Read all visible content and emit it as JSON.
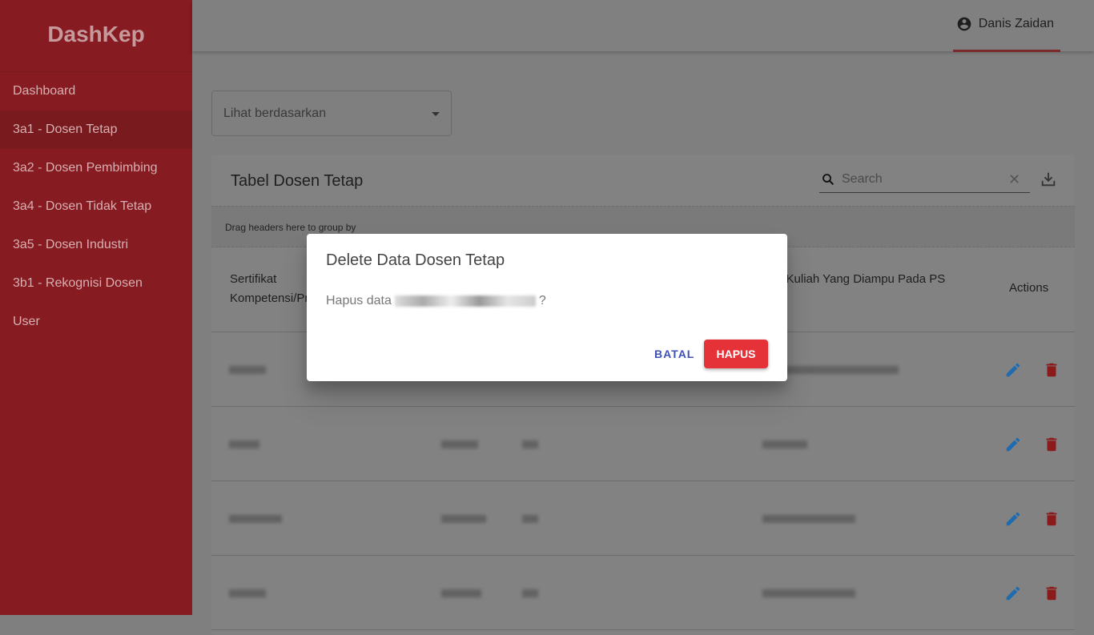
{
  "sidebar": {
    "brand": "DashKep",
    "items": [
      {
        "label": "Dashboard"
      },
      {
        "label": "3a1 - Dosen Tetap",
        "active": true
      },
      {
        "label": "3a2 - Dosen Pembimbing"
      },
      {
        "label": "3a4 - Dosen Tidak Tetap"
      },
      {
        "label": "3a5 - Dosen Industri"
      },
      {
        "label": "3b1 - Rekognisi Dosen"
      },
      {
        "label": "User"
      }
    ]
  },
  "topbar": {
    "user_name": "Danis Zaidan"
  },
  "filter": {
    "placeholder": "Lihat berdasarkan"
  },
  "table": {
    "title": "Tabel Dosen Tetap",
    "search_placeholder": "Search",
    "group_hint": "Drag headers here to group by",
    "columns": [
      "Sertifikat Kompetensi/Profesi/Industri",
      "Mata Kuliah Yang Diampu Pada PS Lain",
      "Actions"
    ]
  },
  "dialog": {
    "title": "Delete Data Dosen Tetap",
    "message_prefix": "Hapus data",
    "message_suffix": "?",
    "cancel_label": "BATAL",
    "confirm_label": "HAPUS"
  },
  "colors": {
    "accent": "#e53238",
    "edit": "#1e6bb0",
    "delete": "#8b1a1a"
  }
}
